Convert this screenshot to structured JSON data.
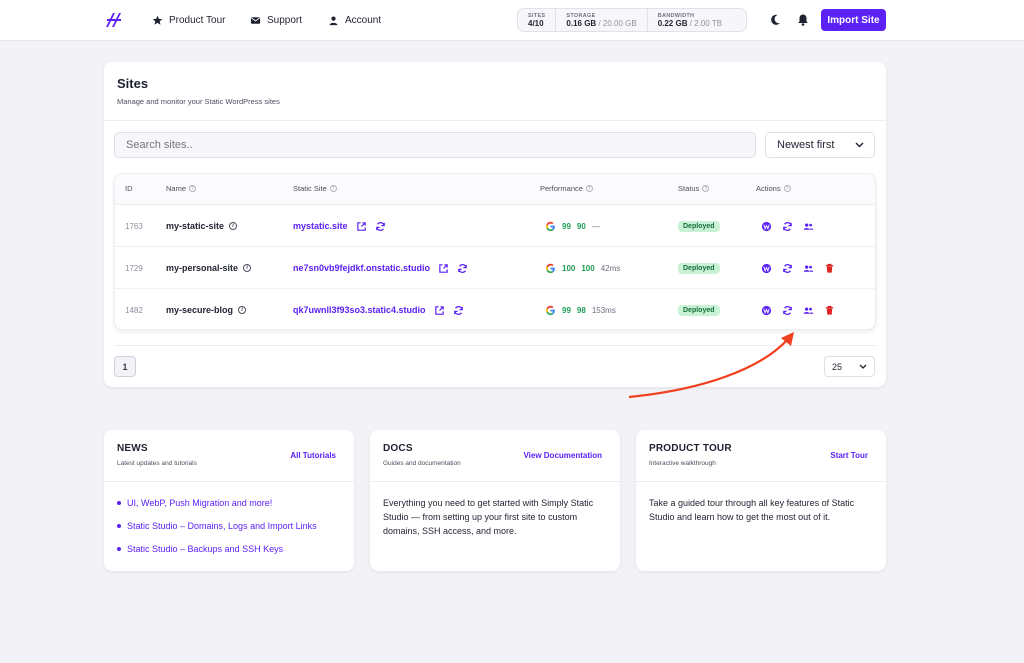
{
  "nav": {
    "product_tour": "Product Tour",
    "support": "Support",
    "account": "Account",
    "usage": {
      "sites_label": "SITES",
      "sites_value": "4/10",
      "storage_label": "STORAGE",
      "storage_used": "0.16 GB",
      "storage_total": "/ 20.00 GB",
      "bandwidth_label": "BANDWIDTH",
      "bandwidth_used": "0.22 GB",
      "bandwidth_total": "/ 2.00 TB"
    },
    "import_label": "Import Site",
    "icons": [
      "logo-icon",
      "star-icon",
      "mail-icon",
      "user-icon",
      "moon-icon",
      "bell-icon"
    ]
  },
  "sites": {
    "title": "Sites",
    "subtitle": "Manage and monitor your Static WordPress sites",
    "search_placeholder": "Search sites..",
    "sort_value": "Newest first",
    "columns": {
      "id": "ID",
      "name": "Name",
      "static_site": "Static Site",
      "performance": "Performance",
      "status": "Status",
      "actions": "Actions"
    },
    "rows": [
      {
        "id": "1763",
        "name": "my-static-site",
        "url": "mystatic.site",
        "score1": "99",
        "score2": "90",
        "time": "—",
        "status": "Deployed"
      },
      {
        "id": "1729",
        "name": "my-personal-site",
        "url": "ne7sn0vb9fejdkf.onstatic.studio",
        "score1": "100",
        "score2": "100",
        "time": "42ms",
        "status": "Deployed"
      },
      {
        "id": "1482",
        "name": "my-secure-blog",
        "url": "qk7uwnll3f93so3.static4.studio",
        "score1": "99",
        "score2": "98",
        "time": "153ms",
        "status": "Deployed"
      }
    ],
    "page": "1",
    "per_page": "25"
  },
  "news": {
    "title": "NEWS",
    "subtitle": "Latest updates and tutorials",
    "link": "All Tutorials",
    "items": [
      "UI, WebP, Push Migration and more!",
      "Static Studio – Domains, Logs and Import Links",
      "Static Studio – Backups and SSH Keys"
    ]
  },
  "docs": {
    "title": "DOCS",
    "subtitle": "Guides and documentation",
    "link": "View Documentation",
    "body": "Everything you need to get started with Simply Static Studio — from setting up your first site to custom domains, SSH access, and more."
  },
  "tour": {
    "title": "PRODUCT TOUR",
    "subtitle": "Interactive walkthrough",
    "link": "Start Tour",
    "body": "Take a guided tour through all key features of Static Studio and learn how to get the most out of it."
  },
  "colors": {
    "accent": "#5b21f5",
    "success": "#1f9d55",
    "danger": "#e02424",
    "arrow": "#f0401f"
  }
}
